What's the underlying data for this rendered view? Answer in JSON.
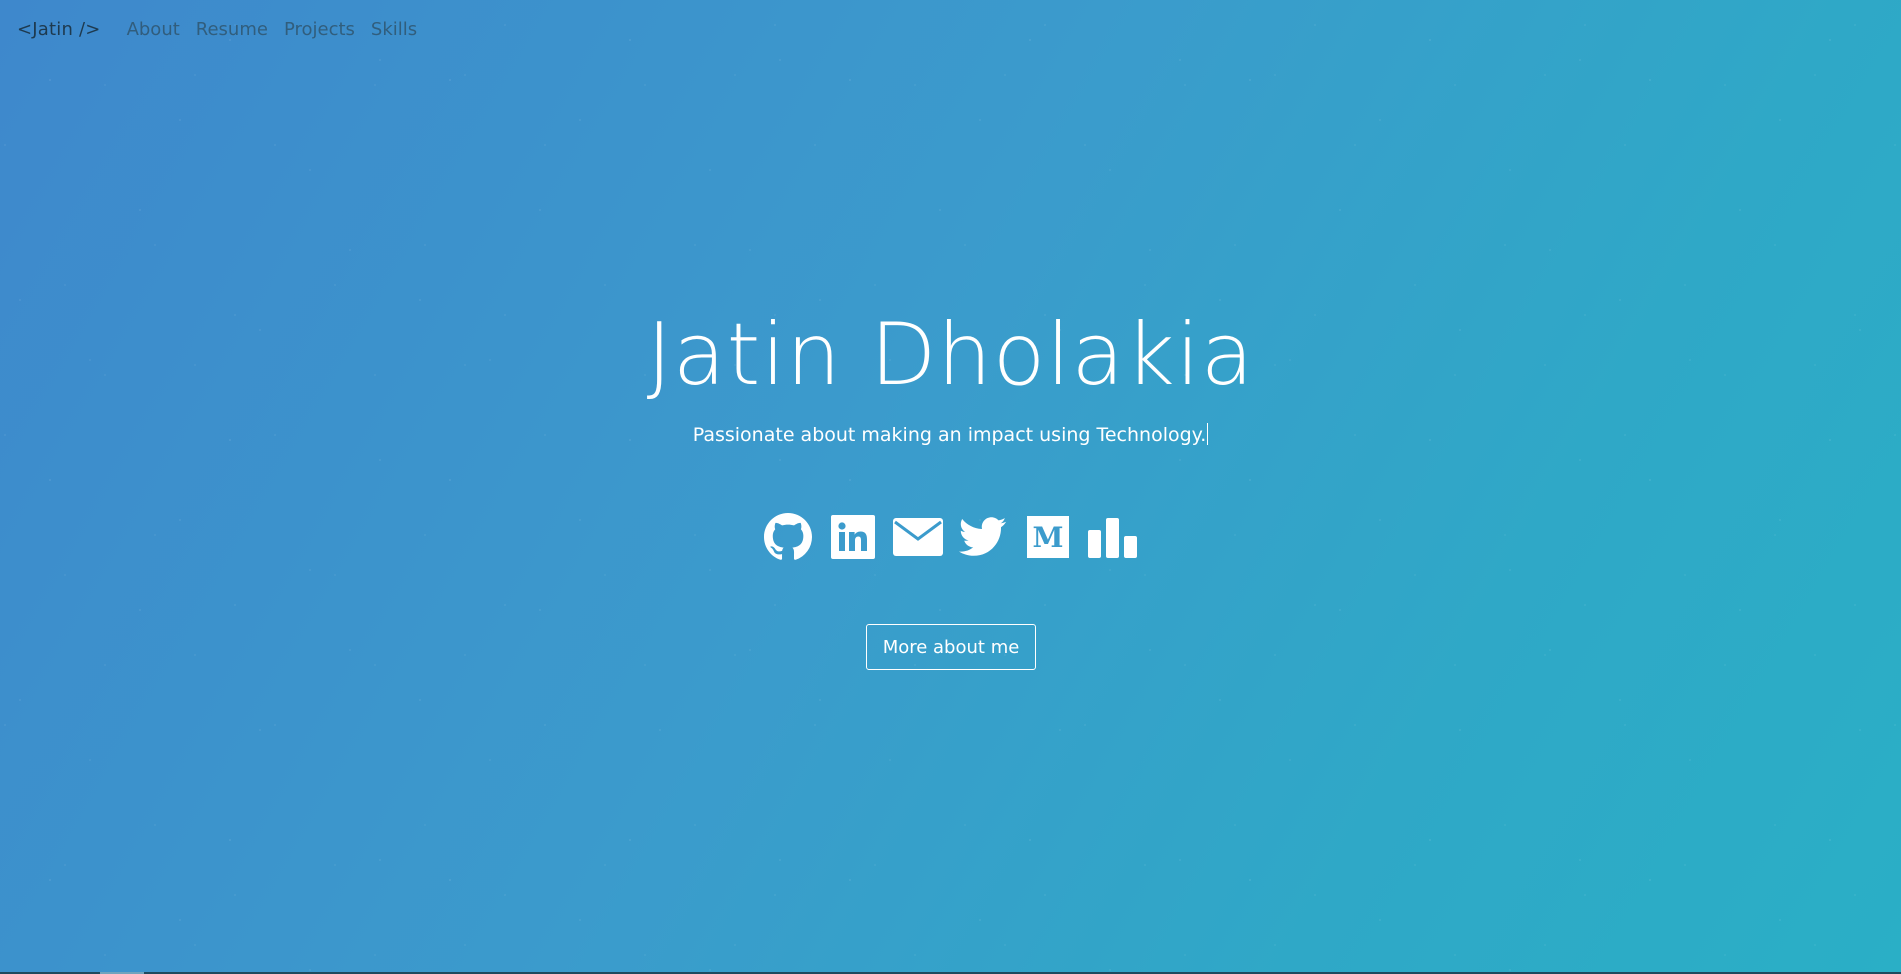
{
  "navbar": {
    "brand": "<Jatin />",
    "links": [
      "About",
      "Resume",
      "Projects",
      "Skills"
    ]
  },
  "hero": {
    "name": "Jatin Dholakia",
    "tagline": "Passionate about making an impact using Technology.",
    "button_label": "More about me"
  },
  "socials": [
    {
      "name": "github-icon"
    },
    {
      "name": "linkedin-icon"
    },
    {
      "name": "email-icon"
    },
    {
      "name": "twitter-icon"
    },
    {
      "name": "medium-icon"
    },
    {
      "name": "stats-icon"
    }
  ],
  "colors": {
    "background_start": "#3e88cc",
    "background_end": "#2aafc6",
    "text": "#ffffff",
    "nav_text": "#2f5670"
  }
}
